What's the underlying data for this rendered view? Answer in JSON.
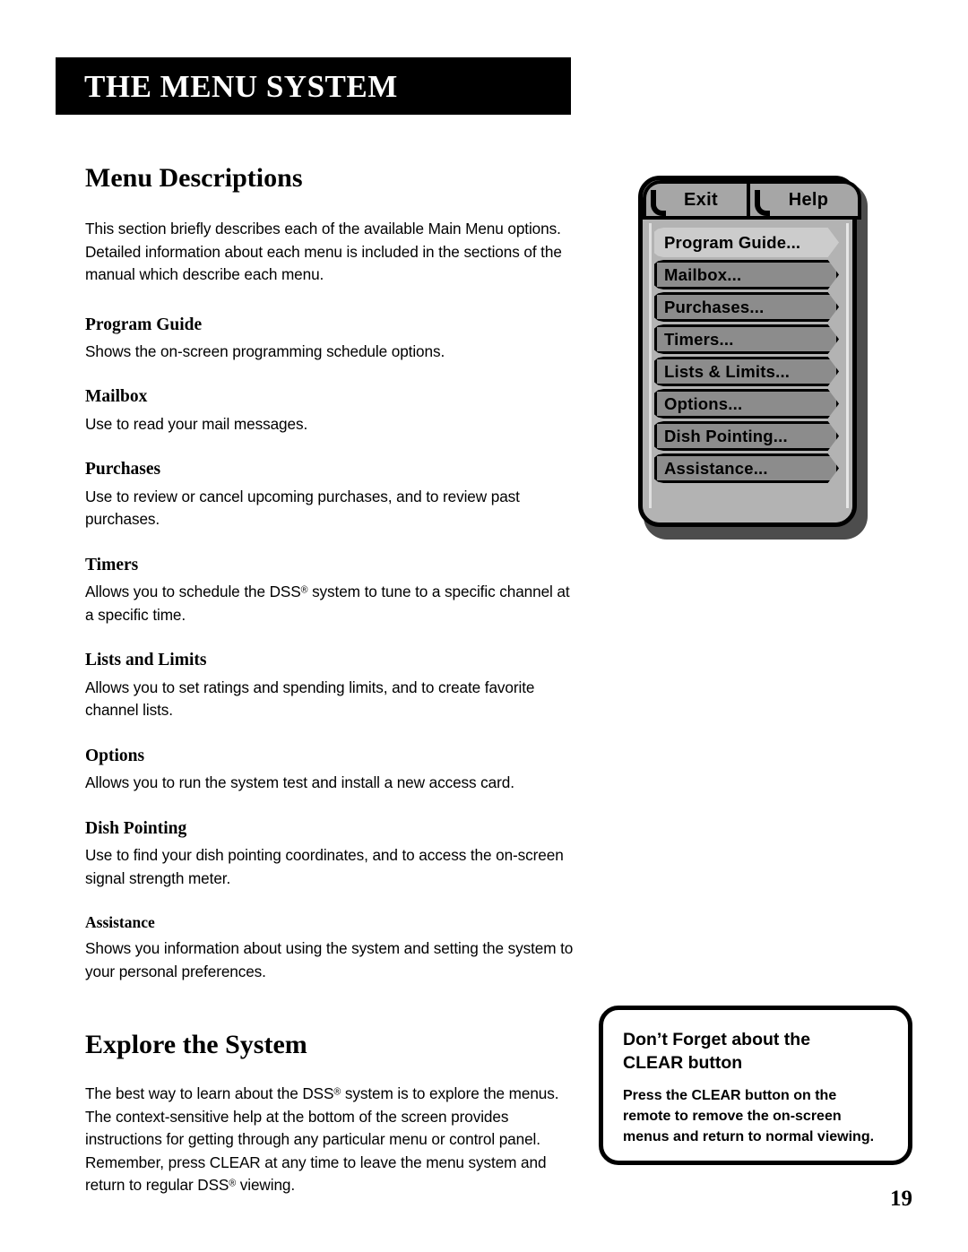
{
  "header": {
    "banner_title": "THE MENU SYSTEM"
  },
  "main": {
    "section_title": "Menu Descriptions",
    "intro": "This section briefly describes each of the available Main Menu options. Detailed information about each menu is included in the sections of the manual which describe each menu.",
    "entries": [
      {
        "heading": "Program Guide",
        "body_pre": "Shows the on-screen programming schedule options.",
        "body_post": ""
      },
      {
        "heading": "Mailbox",
        "body_pre": "Use to read your mail messages.",
        "body_post": ""
      },
      {
        "heading": "Purchases",
        "body_pre": "Use to review or cancel upcoming purchases, and to review past purchases.",
        "body_post": ""
      },
      {
        "heading": "Timers",
        "body_pre": "Allows you to schedule the DSS",
        "body_post": " system to tune to a specific channel at a specific time."
      },
      {
        "heading": "Lists and Limits",
        "body_pre": "Allows you to set ratings and spending limits, and to create favorite channel lists.",
        "body_post": ""
      },
      {
        "heading": "Options",
        "body_pre": "Allows you to run the system test and install a new access card.",
        "body_post": ""
      },
      {
        "heading": "Dish Pointing",
        "body_pre": "Use to find your dish pointing coordinates, and to access the on-screen signal strength meter.",
        "body_post": ""
      },
      {
        "heading": "Assistance",
        "body_pre": "Shows you information about using the system and setting the system to your personal preferences.",
        "body_post": ""
      }
    ],
    "explore_title": "Explore the System",
    "explore_part1": "The best way to learn about the DSS",
    "explore_part2": " system is to explore the menus. The context-sensitive help at the bottom of the screen provides instructions for getting through any particular menu or control panel. Remember, press CLEAR at any time to leave the menu system and return to regular DSS",
    "explore_part3": " viewing.",
    "registered_mark": "®"
  },
  "osd_menu": {
    "tabs": [
      {
        "label": "Exit"
      },
      {
        "label": "Help"
      }
    ],
    "items": [
      {
        "label": "Program Guide...",
        "selected": true
      },
      {
        "label": "Mailbox...",
        "selected": false
      },
      {
        "label": "Purchases...",
        "selected": false
      },
      {
        "label": "Timers...",
        "selected": false
      },
      {
        "label": "Lists & Limits...",
        "selected": false
      },
      {
        "label": "Options...",
        "selected": false
      },
      {
        "label": "Dish Pointing...",
        "selected": false
      },
      {
        "label": "Assistance...",
        "selected": false
      }
    ],
    "colors": {
      "panel": "#b3b3b3",
      "button": "#8c8c8c",
      "button_selected": "#cccccc",
      "outline": "#000000"
    }
  },
  "callout": {
    "title_line1": "Don’t Forget about the",
    "title_line2": "CLEAR button",
    "body": "Press the CLEAR button on the remote to remove the on-screen menus and return to normal viewing."
  },
  "footer": {
    "page_number": "19"
  }
}
